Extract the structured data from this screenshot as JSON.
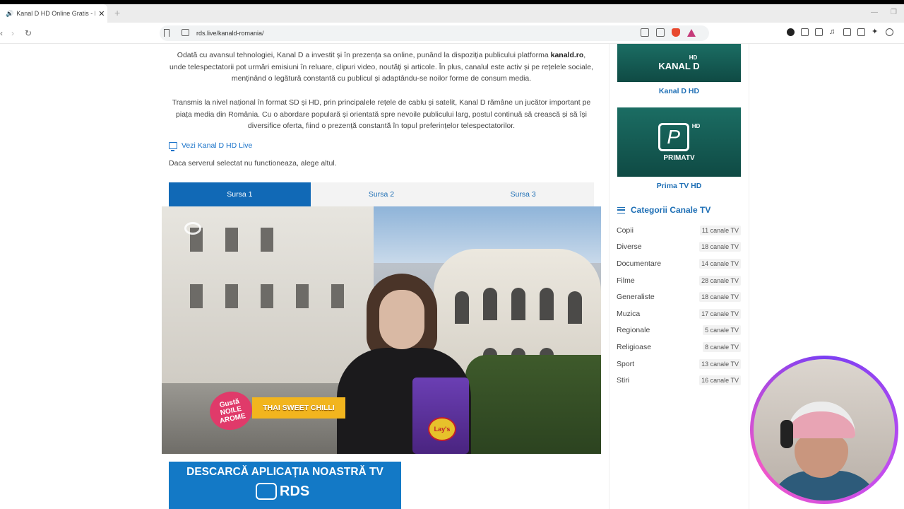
{
  "browser": {
    "tab_title": "Kanal D HD Online Gratis - RD",
    "tab_close": "✕",
    "new_tab": "+",
    "url": "rds.live/kanald-romania/"
  },
  "article": {
    "para1_a": "Odată cu avansul tehnologiei, Kanal D a investit și în prezența sa online, punând la dispoziția publicului platforma ",
    "para1_link": "kanald.ro",
    "para1_b": ", unde telespectatorii pot urmări emisiuni în reluare, clipuri video, noutăți și articole. În plus, canalul este activ și pe rețelele sociale, menținând o legătură constantă cu publicul și adaptându-se noilor forme de consum media.",
    "para2": "Transmis la nivel național în format SD și HD, prin principalele rețele de cablu și satelit, Kanal D rămâne un jucător important pe piața media din România. Cu o abordare populară și orientată spre nevoile publicului larg, postul continuă să crească și să își diversifice oferta, fiind o prezență constantă în topul preferințelor telespectatorilor.",
    "live_link": "Vezi Kanal D HD Live",
    "server_note": "Daca serverul selectat nu functioneaza, alege altul."
  },
  "source_tabs": [
    {
      "label": "Sursa 1",
      "active": true
    },
    {
      "label": "Sursa 2",
      "active": false
    },
    {
      "label": "Sursa 3",
      "active": false
    }
  ],
  "video": {
    "promo_badge": "Gustă NOILE AROME",
    "promo_text": "THAI SWEET CHILLI",
    "bag_brand": "Lay's"
  },
  "app_banner": {
    "title": "DESCARCĂ APLICAȚIA NOASTRĂ TV",
    "brand": "RDS"
  },
  "sidebar": {
    "channels": [
      {
        "name": "Kanal D HD",
        "logo": "KANAL D",
        "badge": "HD"
      },
      {
        "name": "Prima TV HD",
        "logo": "PRIMATV",
        "badge": "HD",
        "mark": "P"
      }
    ],
    "categories_title": "Categorii Canale TV",
    "categories": [
      {
        "name": "Copii",
        "count": "11 canale TV"
      },
      {
        "name": "Diverse",
        "count": "18 canale TV"
      },
      {
        "name": "Documentare",
        "count": "14 canale TV"
      },
      {
        "name": "Filme",
        "count": "28 canale TV"
      },
      {
        "name": "Generaliste",
        "count": "18 canale TV"
      },
      {
        "name": "Muzica",
        "count": "17 canale TV"
      },
      {
        "name": "Regionale",
        "count": "5 canale TV"
      },
      {
        "name": "Religioase",
        "count": "8 canale TV"
      },
      {
        "name": "Sport",
        "count": "13 canale TV"
      },
      {
        "name": "Stiri",
        "count": "16 canale TV"
      }
    ]
  },
  "colors": {
    "accent": "#1169b6",
    "link": "#1e6fb5",
    "banner": "#1379c6",
    "thumb": "#1b6d63"
  }
}
